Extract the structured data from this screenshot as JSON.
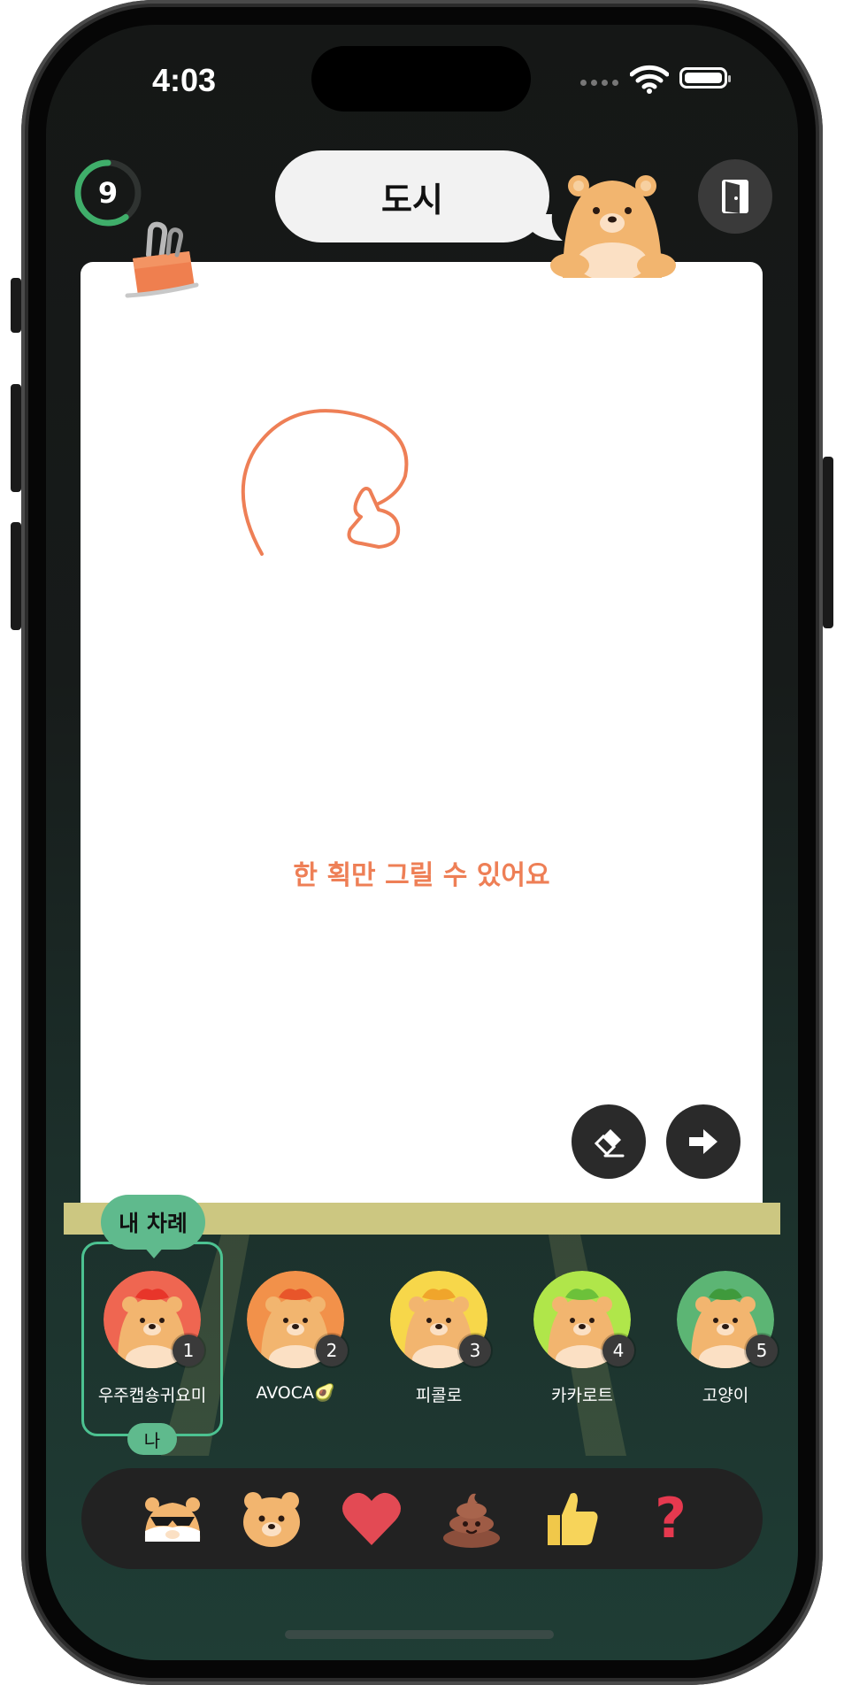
{
  "status_bar": {
    "time": "4:03"
  },
  "game": {
    "timer_value": "9",
    "timer_progress": 0.6,
    "word": "도시",
    "hint": "한 획만 그릴 수 있어요",
    "turn_label": "내 차례",
    "me_label": "나"
  },
  "players": [
    {
      "number": "1",
      "name": "우주캡숑귀요미",
      "color": "#ef6651",
      "hat": "#e8352a"
    },
    {
      "number": "2",
      "name": "AVOCA🥑",
      "color": "#f2914a",
      "hat": "#e8552a"
    },
    {
      "number": "3",
      "name": "피콜로",
      "color": "#f7d74a",
      "hat": "#f0a52b"
    },
    {
      "number": "4",
      "name": "카카로트",
      "color": "#b0e64a",
      "hat": "#6cc13a"
    },
    {
      "number": "5",
      "name": "고양이",
      "color": "#5cb574",
      "hat": "#3f9a3c"
    }
  ],
  "reactions": [
    "hamster-sunglasses",
    "bear-face",
    "heart",
    "poop",
    "thumbs-up",
    "question-mark"
  ],
  "question_mark": "?",
  "colors": {
    "accent_green": "#5fba8d",
    "hint_orange": "#ee7f56",
    "shelf": "#ccc781"
  }
}
